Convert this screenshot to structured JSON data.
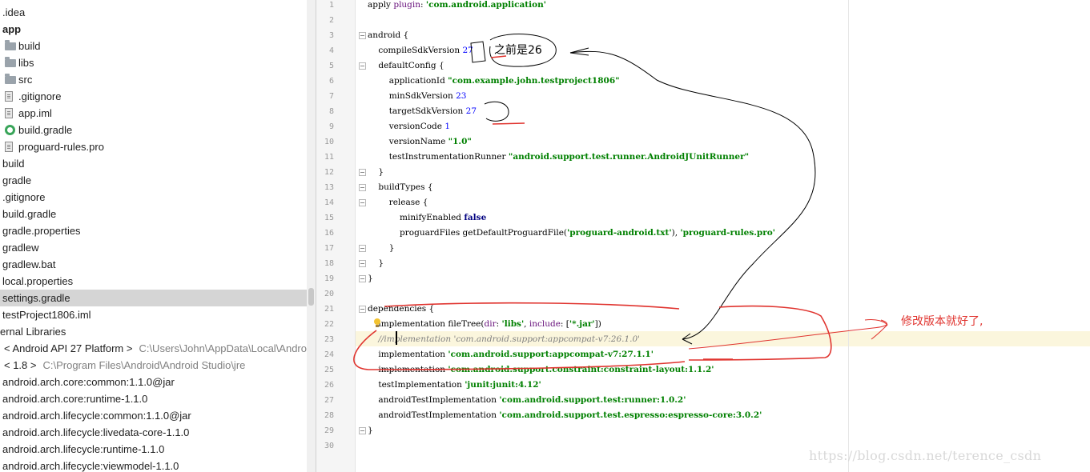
{
  "project_tree": {
    "rows": [
      {
        "label": ".idea",
        "icon": "none",
        "indent": 3
      },
      {
        "label": "app",
        "icon": "none",
        "indent": 3,
        "bold": true
      },
      {
        "label": "build",
        "icon": "folder-icon",
        "indent": 23
      },
      {
        "label": "libs",
        "icon": "folder-icon",
        "indent": 23
      },
      {
        "label": "src",
        "icon": "folder-icon",
        "indent": 23
      },
      {
        "label": ".gitignore",
        "icon": "file-icon",
        "indent": 23
      },
      {
        "label": "app.iml",
        "icon": "file-icon",
        "indent": 23
      },
      {
        "label": "build.gradle",
        "icon": "gradle-icon",
        "indent": 23
      },
      {
        "label": "proguard-rules.pro",
        "icon": "file-icon",
        "indent": 23
      },
      {
        "label": "build",
        "icon": "none",
        "indent": 3
      },
      {
        "label": "gradle",
        "icon": "none",
        "indent": 3
      },
      {
        "label": ".gitignore",
        "icon": "none",
        "indent": 3
      },
      {
        "label": "build.gradle",
        "icon": "none",
        "indent": 3
      },
      {
        "label": "gradle.properties",
        "icon": "none",
        "indent": 3
      },
      {
        "label": "gradlew",
        "icon": "none",
        "indent": 3
      },
      {
        "label": "gradlew.bat",
        "icon": "none",
        "indent": 3
      },
      {
        "label": "local.properties",
        "icon": "none",
        "indent": 3
      },
      {
        "label": "settings.gradle",
        "icon": "none",
        "indent": 3,
        "selected": true
      },
      {
        "label": "testProject1806.iml",
        "icon": "none",
        "indent": 3
      },
      {
        "label": "ernal Libraries",
        "icon": "none",
        "indent": 0
      },
      {
        "label": "< Android API 27 Platform >",
        "path": "C:\\Users\\John\\AppData\\Local\\Android",
        "icon": "none",
        "indent": 5
      },
      {
        "label": "< 1.8 >",
        "path": "C:\\Program Files\\Android\\Android Studio\\jre",
        "icon": "none",
        "indent": 5
      },
      {
        "label": "android.arch.core:common:1.1.0@jar",
        "icon": "none",
        "indent": 3
      },
      {
        "label": "android.arch.core:runtime-1.1.0",
        "icon": "none",
        "indent": 3
      },
      {
        "label": "android.arch.lifecycle:common:1.1.0@jar",
        "icon": "none",
        "indent": 3
      },
      {
        "label": "android.arch.lifecycle:livedata-core-1.1.0",
        "icon": "none",
        "indent": 3
      },
      {
        "label": "android.arch.lifecycle:runtime-1.1.0",
        "icon": "none",
        "indent": 3
      },
      {
        "label": "android.arch.lifecycle:viewmodel-1.1.0",
        "icon": "none",
        "indent": 3
      }
    ]
  },
  "editor": {
    "line_numbers": [
      "1",
      "2",
      "3",
      "4",
      "5",
      "6",
      "7",
      "8",
      "9",
      "10",
      "11",
      "12",
      "13",
      "14",
      "15",
      "16",
      "17",
      "18",
      "19",
      "20",
      "21",
      "22",
      "23",
      "24",
      "25",
      "26",
      "27",
      "28",
      "29",
      "30"
    ],
    "lines": [
      [
        {
          "t": "apply ",
          "c": ""
        },
        {
          "t": "plugin",
          "c": "named"
        },
        {
          "t": ": ",
          "c": ""
        },
        {
          "t": "'com.android.application'",
          "c": "str"
        }
      ],
      [],
      [
        {
          "t": "android {",
          "c": ""
        }
      ],
      [
        {
          "t": "    compileSdkVersion ",
          "c": ""
        },
        {
          "t": "27",
          "c": "num"
        }
      ],
      [
        {
          "t": "    defaultConfig {",
          "c": ""
        }
      ],
      [
        {
          "t": "        applicationId ",
          "c": ""
        },
        {
          "t": "\"com.example.john.testproject1806\"",
          "c": "str"
        }
      ],
      [
        {
          "t": "        minSdkVersion ",
          "c": ""
        },
        {
          "t": "23",
          "c": "num"
        }
      ],
      [
        {
          "t": "        targetSdkVersion ",
          "c": ""
        },
        {
          "t": "27",
          "c": "num"
        }
      ],
      [
        {
          "t": "        versionCode ",
          "c": ""
        },
        {
          "t": "1",
          "c": "num"
        }
      ],
      [
        {
          "t": "        versionName ",
          "c": ""
        },
        {
          "t": "\"1.0\"",
          "c": "str"
        }
      ],
      [
        {
          "t": "        testInstrumentationRunner ",
          "c": ""
        },
        {
          "t": "\"android.support.test.runner.AndroidJUnitRunner\"",
          "c": "str"
        }
      ],
      [
        {
          "t": "    }",
          "c": ""
        }
      ],
      [
        {
          "t": "    buildTypes {",
          "c": ""
        }
      ],
      [
        {
          "t": "        release {",
          "c": ""
        }
      ],
      [
        {
          "t": "            minifyEnabled ",
          "c": ""
        },
        {
          "t": "false",
          "c": "kw"
        }
      ],
      [
        {
          "t": "            proguardFiles getDefaultProguardFile(",
          "c": ""
        },
        {
          "t": "'proguard-android.txt'",
          "c": "str"
        },
        {
          "t": "), ",
          "c": ""
        },
        {
          "t": "'proguard-rules.pro'",
          "c": "str"
        }
      ],
      [
        {
          "t": "        }",
          "c": ""
        }
      ],
      [
        {
          "t": "    }",
          "c": ""
        }
      ],
      [
        {
          "t": "}",
          "c": ""
        }
      ],
      [],
      [
        {
          "t": "dependencies {",
          "c": ""
        }
      ],
      [
        {
          "t": "    implementation fileTree(",
          "c": ""
        },
        {
          "t": "dir",
          "c": "named"
        },
        {
          "t": ": ",
          "c": ""
        },
        {
          "t": "'libs'",
          "c": "str"
        },
        {
          "t": ", ",
          "c": ""
        },
        {
          "t": "include",
          "c": "named"
        },
        {
          "t": ": [",
          "c": ""
        },
        {
          "t": "'*.jar'",
          "c": "str"
        },
        {
          "t": "])",
          "c": ""
        }
      ],
      [
        {
          "t": "    //implementation 'com.android.support:appcompat-v7:26.1.0'",
          "c": "cmt"
        }
      ],
      [
        {
          "t": "    implementation ",
          "c": ""
        },
        {
          "t": "'com.android.support:appcompat-v7:27.1.1'",
          "c": "str"
        }
      ],
      [
        {
          "t": "    implementation ",
          "c": ""
        },
        {
          "t": "'com.android.support.constraint:constraint-layout:1.1.2'",
          "c": "str"
        }
      ],
      [
        {
          "t": "    testImplementation ",
          "c": ""
        },
        {
          "t": "'junit:junit:4.12'",
          "c": "str"
        }
      ],
      [
        {
          "t": "    androidTestImplementation ",
          "c": ""
        },
        {
          "t": "'com.android.support.test:runner:1.0.2'",
          "c": "str"
        }
      ],
      [
        {
          "t": "    androidTestImplementation ",
          "c": ""
        },
        {
          "t": "'com.android.support.test.espresso:espresso-core:3.0.2'",
          "c": "str"
        }
      ],
      [
        {
          "t": "}",
          "c": ""
        }
      ],
      []
    ],
    "fold_lines": [
      3,
      5,
      12,
      13,
      14,
      17,
      18,
      19,
      21,
      29
    ]
  },
  "annotations": {
    "before_note": "之前是26",
    "fix_note": "修改版本就好了,",
    "ink_black": "#000000",
    "ink_red": "#e0342f"
  },
  "watermark": "https://blog.csdn.net/terence_csdn",
  "colors": {
    "string": "#008000",
    "number": "#0000ff",
    "keyword": "#000080",
    "comment": "#808080",
    "selection": "#d5d5d5",
    "current_line": "#fbf6dd"
  }
}
